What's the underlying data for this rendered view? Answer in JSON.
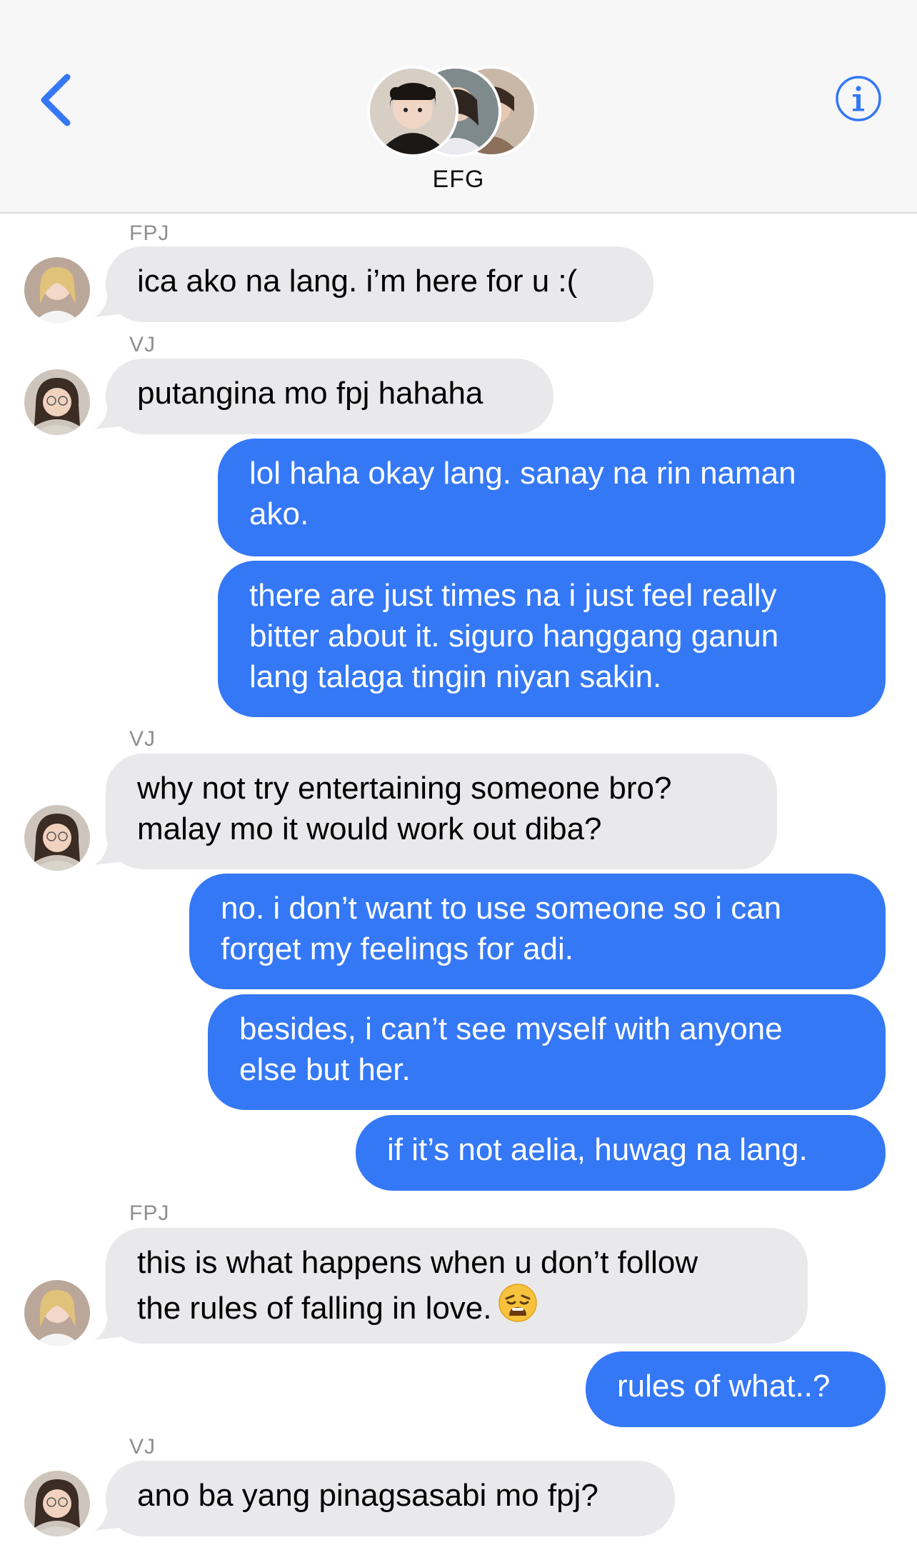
{
  "header": {
    "group_name": "EFG",
    "back_icon": "chevron-left-icon",
    "info_icon": "info-circle-icon"
  },
  "colors": {
    "outgoing_bubble": "#3478f6",
    "incoming_bubble": "#e9e9eb",
    "accent": "#3478f6",
    "sender_label": "#8e8e93"
  },
  "messages": [
    {
      "sender": "FPJ",
      "direction": "incoming",
      "lines": [
        "ica ako na lang. i’m here for u :("
      ]
    },
    {
      "sender": "VJ",
      "direction": "incoming",
      "lines": [
        "putangina mo fpj hahaha"
      ]
    },
    {
      "sender": "",
      "direction": "outgoing",
      "lines": [
        "lol haha okay lang. sanay na rin naman",
        "ako."
      ]
    },
    {
      "sender": "",
      "direction": "outgoing",
      "lines": [
        "there are just times na i just feel really",
        "bitter about it. siguro hanggang ganun",
        "lang talaga tingin niyan sakin."
      ]
    },
    {
      "sender": "VJ",
      "direction": "incoming",
      "lines": [
        "why not try entertaining someone bro?",
        "malay mo it would work out diba?"
      ]
    },
    {
      "sender": "",
      "direction": "outgoing",
      "lines": [
        "no. i don’t want to use someone so i can",
        "forget my feelings for adi."
      ]
    },
    {
      "sender": "",
      "direction": "outgoing",
      "lines": [
        "besides, i can’t see myself with anyone",
        "else but her."
      ]
    },
    {
      "sender": "",
      "direction": "outgoing",
      "lines": [
        "if it’s not aelia, huwag na lang."
      ]
    },
    {
      "sender": "FPJ",
      "direction": "incoming",
      "lines": [
        "this is what happens when u don’t follow",
        "the rules of falling in love."
      ],
      "emoji": "weary-face-emoji"
    },
    {
      "sender": "",
      "direction": "outgoing",
      "lines": [
        "rules of what..?"
      ]
    },
    {
      "sender": "VJ",
      "direction": "incoming",
      "lines": [
        "ano ba yang pinagsasabi mo fpj?"
      ]
    }
  ]
}
